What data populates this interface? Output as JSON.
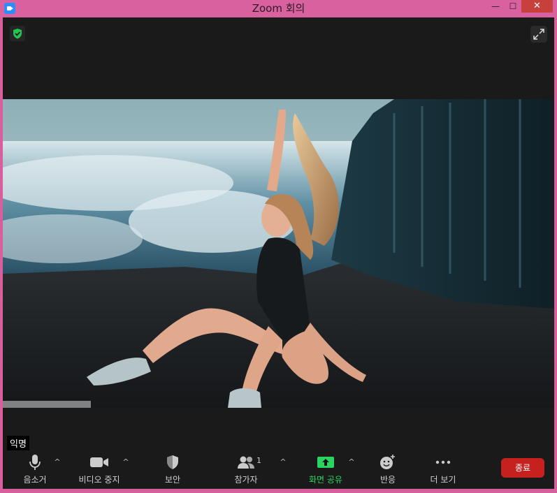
{
  "window": {
    "title": "Zoom 회의",
    "minimize_symbol": "—",
    "maximize_symbol": "☐",
    "close_symbol": "✕"
  },
  "participant": {
    "name": "익명"
  },
  "toolbar": {
    "mute_label": "음소거",
    "video_label": "비디오 중지",
    "security_label": "보안",
    "participants_label": "참가자",
    "participants_count": "1",
    "share_label": "화면 공유",
    "reactions_label": "반응",
    "more_label": "더 보기",
    "end_label": "종료",
    "caret": "^"
  },
  "icons": {
    "security_badge": "shield-check-icon",
    "fullscreen": "expand-icon",
    "mic": "microphone-icon",
    "video": "video-camera-icon",
    "security": "shield-icon",
    "participants": "people-icon",
    "share": "share-arrow-icon",
    "reactions": "smiley-plus-icon",
    "more": "ellipsis-icon"
  },
  "colors": {
    "titlebar": "#d9619f",
    "background": "#1a1a1a",
    "share_accent": "#2bd361",
    "end_button": "#c7211f",
    "security_badge": "#23c552"
  }
}
